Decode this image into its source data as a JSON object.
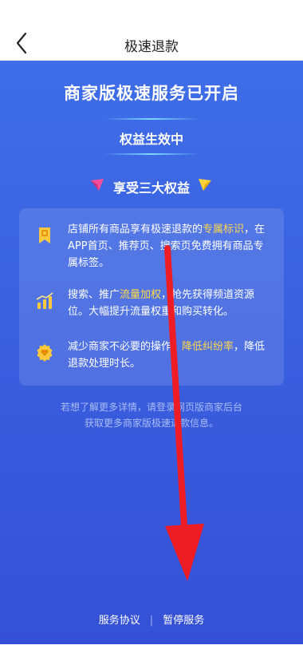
{
  "nav": {
    "title": "极速退款"
  },
  "headline": "商家版极速服务已开启",
  "status": "权益生效中",
  "benefits_title": "享受三大权益",
  "benefits": [
    {
      "icon": "badge-icon",
      "segments": [
        {
          "text": "店铺所有商品享有极速退款的",
          "hl": false
        },
        {
          "text": "专属标识",
          "hl": true
        },
        {
          "text": "，在APP首页、推荐页、搜索页免费拥有商品专属标签。",
          "hl": false
        }
      ]
    },
    {
      "icon": "bar-chart-icon",
      "segments": [
        {
          "text": "搜索、推广",
          "hl": false
        },
        {
          "text": "流量加权",
          "hl": true
        },
        {
          "text": "，抢先获得频道资源位。大幅提升流量权重和购买转化。",
          "hl": false
        }
      ]
    },
    {
      "icon": "heart-coin-icon",
      "segments": [
        {
          "text": "减少商家不必要的操作，",
          "hl": false
        },
        {
          "text": "降低纠纷率",
          "hl": true
        },
        {
          "text": "，降低退款处理时长。",
          "hl": false
        }
      ]
    }
  ],
  "info_line1": "若想了解更多详情，请登录网页版商家后台",
  "info_line2": "获取更多商家版极速退款信息。",
  "footer": {
    "agreement": "服务协议",
    "separator": "|",
    "pause": "暂停服务"
  },
  "colors": {
    "background_top": "#3f6ee8",
    "background_bottom": "#3550d6",
    "highlight": "#ffd84a",
    "arrow": "#ee1c25"
  }
}
